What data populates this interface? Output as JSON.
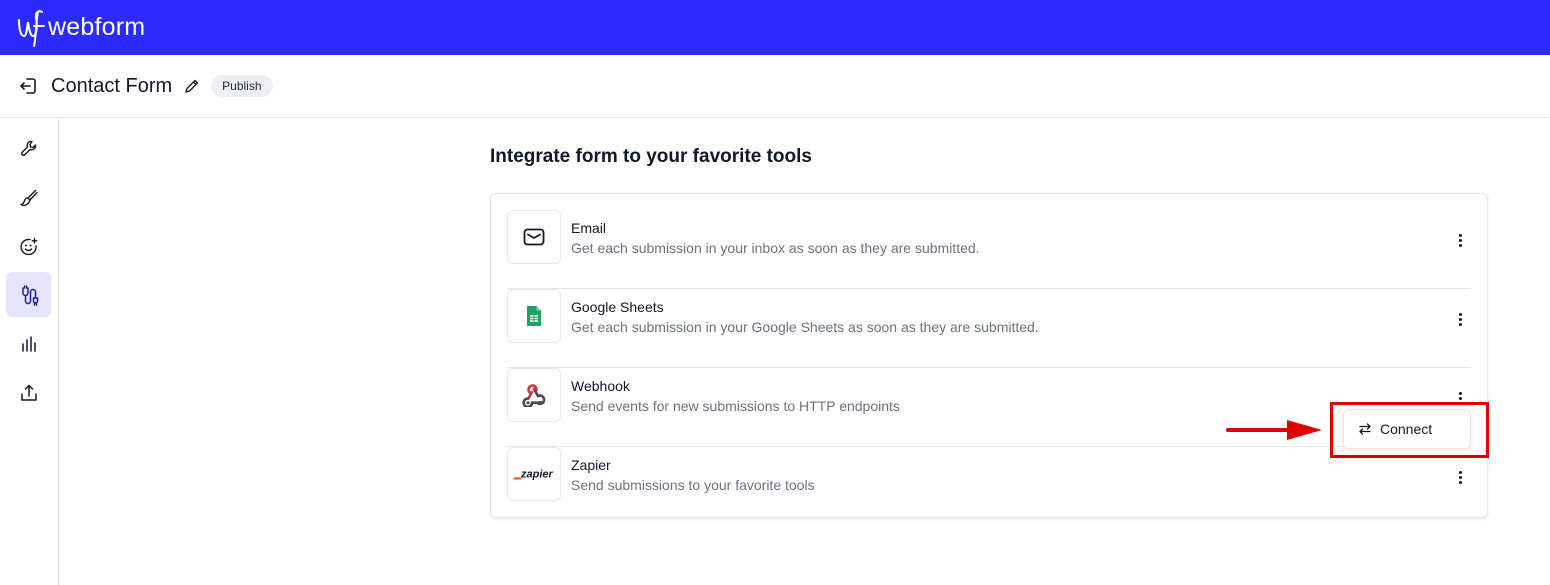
{
  "app": {
    "logo_mark": "wf",
    "logo_text": "webform",
    "brand_color": "#2b2bff"
  },
  "header": {
    "title": "Contact Form",
    "publish_label": "Publish"
  },
  "sidebar": {
    "items": [
      {
        "icon": "wrench-icon",
        "active": false
      },
      {
        "icon": "brush-icon",
        "active": false
      },
      {
        "icon": "smiley-plus-icon",
        "active": false
      },
      {
        "icon": "integrations-icon",
        "active": true
      },
      {
        "icon": "bar-chart-icon",
        "active": false
      },
      {
        "icon": "share-upload-icon",
        "active": false
      }
    ]
  },
  "main": {
    "heading": "Integrate form to your favorite tools",
    "integrations": [
      {
        "name": "Email",
        "description": "Get each submission in your inbox as soon as they are submitted.",
        "icon": "mail-icon"
      },
      {
        "name": "Google Sheets",
        "description": "Get each submission in your Google Sheets as soon as they are submitted.",
        "icon": "google-sheets-icon"
      },
      {
        "name": "Webhook",
        "description": "Send events for new submissions to HTTP endpoints",
        "icon": "webhook-icon"
      },
      {
        "name": "Zapier",
        "description": "Send submissions to your favorite tools",
        "icon": "zapier-logo",
        "logo_text": "_zapier"
      }
    ],
    "menu_popup": {
      "connect_label": "Connect"
    }
  },
  "annotation": {
    "color": "#e00000"
  }
}
